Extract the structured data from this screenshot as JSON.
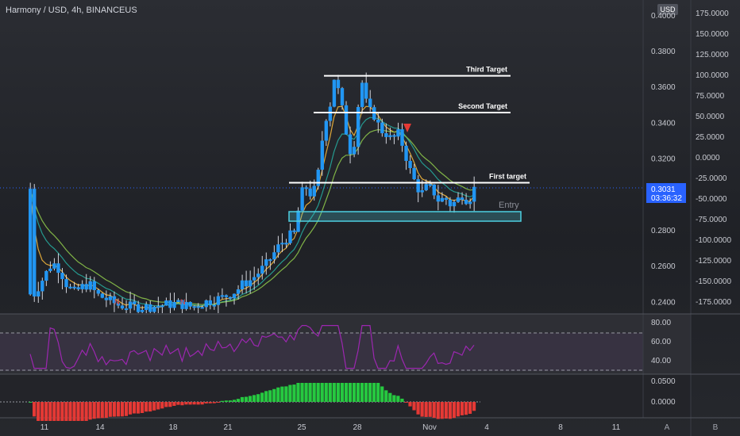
{
  "header": {
    "title": "Harmony / USD, 4h, BINANCEUS",
    "currency_button": "USD"
  },
  "chart_data": {
    "type": "candlestick",
    "symbol": "Harmony / USD",
    "interval": "4h",
    "exchange": "BINANCEUS",
    "x_tick_labels": [
      "11",
      "14",
      "18",
      "21",
      "25",
      "28",
      "Nov",
      "4",
      "8",
      "11"
    ],
    "price_axis_inner": [
      "0.4000",
      "0.3800",
      "0.3600",
      "0.3400",
      "0.3200",
      "0.3000",
      "0.2800",
      "0.2600",
      "0.2400"
    ],
    "price_axis_outer": [
      "175.0000",
      "150.0000",
      "125.0000",
      "100.0000",
      "75.0000",
      "50.0000",
      "25.0000",
      "0.0000",
      "-25.0000",
      "-50.0000",
      "-75.0000",
      "-100.0000",
      "-125.0000",
      "-150.0000",
      "-175.0000"
    ],
    "ylim": [
      0.234,
      0.4
    ],
    "last_price": {
      "value": "0.3031",
      "countdown": "03:36:32",
      "price": 0.3031
    },
    "close_path": [
      [
        0.247,
        0.244
      ],
      [
        1.5,
        0.262
      ],
      [
        2.0,
        0.258
      ],
      [
        2.5,
        0.249
      ],
      [
        3.0,
        0.245
      ],
      [
        3.5,
        0.248
      ],
      [
        4.0,
        0.25
      ],
      [
        4.5,
        0.244
      ],
      [
        5.0,
        0.242
      ],
      [
        6.0,
        0.238
      ],
      [
        7.0,
        0.237
      ],
      [
        8.0,
        0.237
      ],
      [
        9.0,
        0.238
      ],
      [
        10.0,
        0.239
      ],
      [
        11.0,
        0.237
      ],
      [
        12.0,
        0.24
      ],
      [
        13.0,
        0.242
      ],
      [
        14.0,
        0.246
      ],
      [
        14.5,
        0.25
      ],
      [
        15.0,
        0.252
      ],
      [
        15.5,
        0.256
      ],
      [
        16.0,
        0.26
      ],
      [
        16.5,
        0.266
      ],
      [
        17.0,
        0.272
      ],
      [
        17.5,
        0.276
      ],
      [
        18.0,
        0.278
      ],
      [
        18.4,
        0.3
      ],
      [
        18.8,
        0.304
      ],
      [
        19.2,
        0.298
      ],
      [
        19.6,
        0.312
      ],
      [
        20.0,
        0.34
      ],
      [
        20.4,
        0.35
      ],
      [
        20.7,
        0.366
      ],
      [
        21.0,
        0.356
      ],
      [
        21.3,
        0.344
      ],
      [
        21.6,
        0.33
      ],
      [
        21.9,
        0.32
      ],
      [
        22.2,
        0.34
      ],
      [
        22.5,
        0.366
      ],
      [
        22.8,
        0.352
      ],
      [
        23.1,
        0.346
      ],
      [
        23.4,
        0.344
      ],
      [
        23.8,
        0.336
      ],
      [
        24.2,
        0.334
      ],
      [
        24.6,
        0.33
      ],
      [
        25.0,
        0.334
      ],
      [
        25.4,
        0.326
      ],
      [
        25.8,
        0.314
      ],
      [
        26.2,
        0.306
      ],
      [
        26.6,
        0.3
      ],
      [
        27.0,
        0.304
      ],
      [
        27.4,
        0.302
      ],
      [
        27.8,
        0.296
      ],
      [
        28.2,
        0.298
      ],
      [
        28.6,
        0.294
      ],
      [
        29.0,
        0.296
      ],
      [
        29.4,
        0.3
      ],
      [
        29.8,
        0.296
      ],
      [
        30.2,
        0.303
      ]
    ],
    "levels": [
      {
        "name": "Third Target",
        "price": 0.366
      },
      {
        "name": "Second Target",
        "price": 0.3455
      },
      {
        "name": "First target",
        "price": 0.3063
      }
    ],
    "entry_zone": {
      "label": "Entry",
      "from": 0.2868,
      "to": 0.2915
    },
    "rsi": {
      "axis_labels": [
        "80.00",
        "60.00",
        "40.00"
      ],
      "upper_band": 70,
      "lower_band": 30
    },
    "macd": {
      "axis_labels": [
        "0.0500",
        "0.0000"
      ]
    }
  },
  "footer": {
    "button_a": "A",
    "button_b": "B"
  },
  "colors": {
    "candle": "#2196f3",
    "ema_fast": "#f2b63c",
    "ema_slow": "#26a69a",
    "target_line": "#ffffff",
    "entry_zone": "#4dd0e1",
    "price_tag": "#2962ff",
    "rsi_line": "#9c27b0",
    "hist_up": "#26c940",
    "hist_down": "#e53935"
  }
}
